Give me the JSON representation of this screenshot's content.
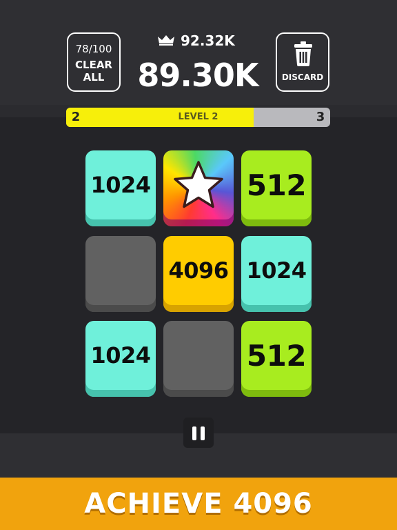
{
  "header": {
    "clear": {
      "count": "78/100",
      "label": "CLEAR\nALL"
    },
    "best_score": "92.32K",
    "score": "89.30K",
    "discard_label": "DISCARD"
  },
  "level": {
    "current": "2",
    "next": "3",
    "label": "LEVEL 2",
    "progress": 0.71,
    "fill_color": "#f7ef0a"
  },
  "board": {
    "tiles": [
      {
        "value": "1024",
        "type": "cyan"
      },
      {
        "value": "",
        "type": "star"
      },
      {
        "value": "512",
        "type": "green"
      },
      {
        "value": "",
        "type": "empty"
      },
      {
        "value": "4096",
        "type": "gold"
      },
      {
        "value": "1024",
        "type": "cyan"
      },
      {
        "value": "1024",
        "type": "cyan"
      },
      {
        "value": "",
        "type": "empty"
      },
      {
        "value": "512",
        "type": "green"
      }
    ]
  },
  "banner": {
    "text": "ACHIEVE 4096"
  },
  "icons": [
    "crown-icon",
    "trash-icon",
    "star-icon",
    "pause-icon"
  ]
}
